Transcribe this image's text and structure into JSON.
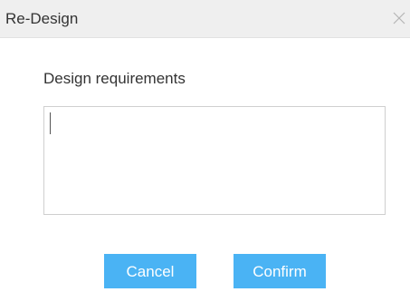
{
  "dialog": {
    "title": "Re-Design",
    "close_icon": "close-icon",
    "field_label": "Design requirements",
    "textarea_value": "",
    "textarea_placeholder": "",
    "cancel_label": "Cancel",
    "confirm_label": "Confirm"
  },
  "colors": {
    "titlebar_bg": "#efefef",
    "button_bg": "#4ab3f4",
    "button_text": "#ffffff",
    "text": "#333333"
  }
}
